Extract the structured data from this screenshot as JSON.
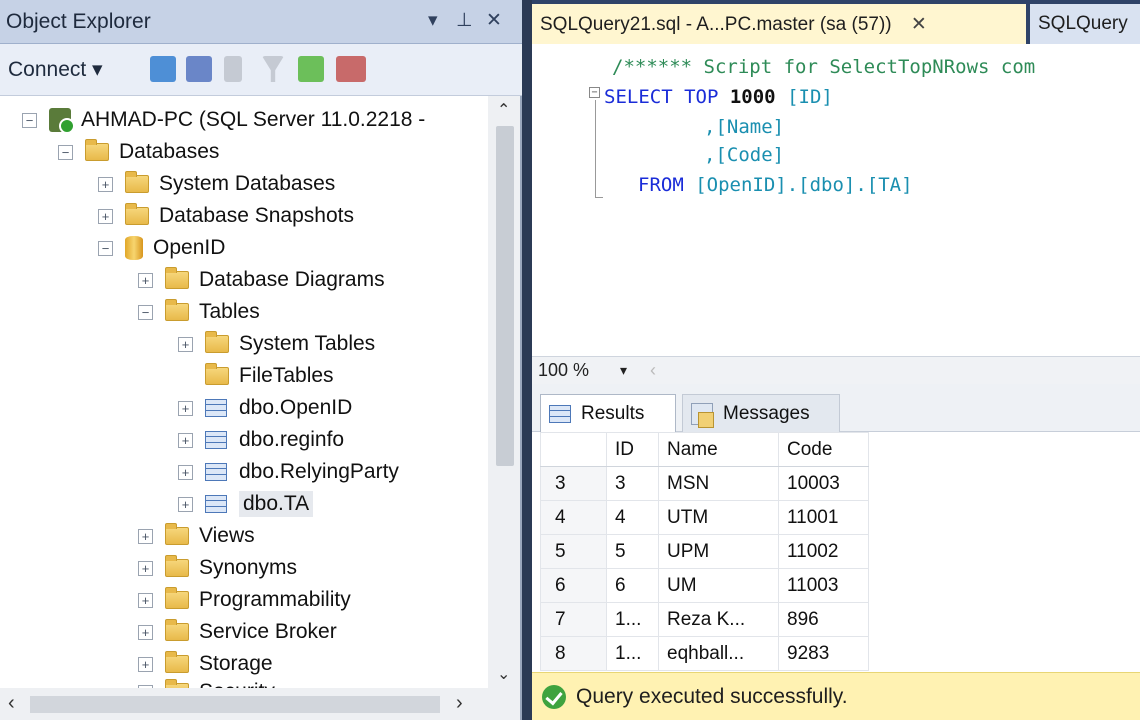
{
  "object_explorer": {
    "title": "Object Explorer",
    "window_controls": [
      "▾",
      "⊥",
      "✕"
    ],
    "toolbar": {
      "connect_label": "Connect ▾"
    },
    "tree": {
      "server": "AHMAD-PC (SQL Server 11.0.2218 -",
      "databases": "Databases",
      "system_databases": "System Databases",
      "database_snapshots": "Database Snapshots",
      "openid": "OpenID",
      "database_diagrams": "Database Diagrams",
      "tables": "Tables",
      "system_tables": "System Tables",
      "file_tables": "FileTables",
      "table_openid": "dbo.OpenID",
      "table_reginfo": "dbo.reginfo",
      "table_relyingparty": "dbo.RelyingParty",
      "table_ta": "dbo.TA",
      "views": "Views",
      "synonyms": "Synonyms",
      "programmability": "Programmability",
      "service_broker": "Service Broker",
      "storage": "Storage",
      "security": "Security"
    }
  },
  "query_editor": {
    "tabs": {
      "active": "SQLQuery21.sql - A...PC.master (sa (57))",
      "active_close": "✕",
      "inactive": "SQLQuery"
    },
    "code": {
      "comment": "/****** Script for SelectTopNRows com",
      "select_kw": "SELECT TOP",
      "top_n": "1000",
      "col_id": "[ID]",
      "col_name": ",[Name]",
      "col_code": ",[Code]",
      "from_kw": "FROM",
      "from_target": "[OpenID].[dbo].[TA]"
    },
    "zoom": "100 %",
    "result_tabs": {
      "results": "Results",
      "messages": "Messages"
    },
    "results_grid": {
      "columns": [
        "ID",
        "Name",
        "Code"
      ],
      "rows": [
        {
          "rownum": "3",
          "id": "3",
          "name": "MSN",
          "code": "10003"
        },
        {
          "rownum": "4",
          "id": "4",
          "name": "UTM",
          "code": "11001"
        },
        {
          "rownum": "5",
          "id": "5",
          "name": "UPM",
          "code": "11002"
        },
        {
          "rownum": "6",
          "id": "6",
          "name": "UM",
          "code": "11003"
        },
        {
          "rownum": "7",
          "id": "1...",
          "name": "Reza K...",
          "code": "896"
        },
        {
          "rownum": "8",
          "id": "1...",
          "name": "eqhball...",
          "code": "9283"
        }
      ]
    },
    "status": "Query executed successfully."
  },
  "colors": {
    "title_bar": "#c6d2e6",
    "active_tab": "#fff6d0",
    "status_bar": "#fff2b2",
    "keyword": "#1a2cd8",
    "comment": "#2e8b57"
  }
}
